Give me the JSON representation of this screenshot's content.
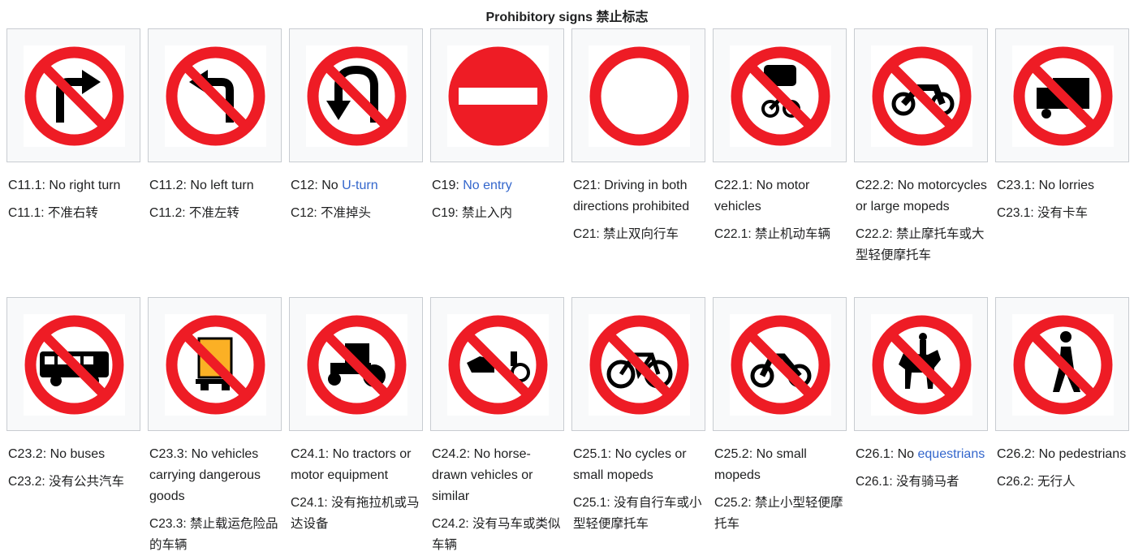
{
  "title": "Prohibitory signs 禁止标志",
  "colors": {
    "sign_red": "#ee1c25",
    "link": "#3366cc",
    "hazard": "#fbb025"
  },
  "rows": [
    [
      {
        "icon": "no-right-turn-icon",
        "code": "C11.1:",
        "en": "No right turn",
        "en_link": "",
        "zh": "C11.1: 不准右转"
      },
      {
        "icon": "no-left-turn-icon",
        "code": "C11.2:",
        "en": "No left turn",
        "en_link": "",
        "zh": "C11.2: 不准左转"
      },
      {
        "icon": "no-u-turn-icon",
        "code": "C12:",
        "en": "No",
        "en_link": "U-turn",
        "zh": "C12: 不准掉头"
      },
      {
        "icon": "no-entry-icon",
        "code": "C19:",
        "en": "",
        "en_link": "No entry",
        "zh": "C19: 禁止入内"
      },
      {
        "icon": "no-vehicles-both-directions-icon",
        "code": "C21:",
        "en": "Driving in both directions prohibited",
        "en_link": "",
        "zh": "C21: 禁止双向行车"
      },
      {
        "icon": "no-motor-vehicles-icon",
        "code": "C22.1:",
        "en": "No motor vehicles",
        "en_link": "",
        "zh": "C22.1: 禁止机动车辆"
      },
      {
        "icon": "no-motorcycles-icon",
        "code": "C22.2:",
        "en": "No motorcycles or large mopeds",
        "en_link": "",
        "zh": "C22.2: 禁止摩托车或大型轻便摩托车"
      },
      {
        "icon": "no-lorries-icon",
        "code": "C23.1:",
        "en": "No lorries",
        "en_link": "",
        "zh": "C23.1: 没有卡车"
      }
    ],
    [
      {
        "icon": "no-buses-icon",
        "code": "C23.2:",
        "en": "No buses",
        "en_link": "",
        "zh": "C23.2: 没有公共汽车"
      },
      {
        "icon": "no-dangerous-goods-icon",
        "code": "C23.3:",
        "en": "No vehicles carrying dangerous goods",
        "en_link": "",
        "zh": "C23.3: 禁止载运危险品的车辆"
      },
      {
        "icon": "no-tractors-icon",
        "code": "C24.1:",
        "en": "No tractors or motor equipment",
        "en_link": "",
        "zh": "C24.1: 没有拖拉机或马达设备"
      },
      {
        "icon": "no-horse-drawn-icon",
        "code": "C24.2:",
        "en": "No horse-drawn vehicles or similar",
        "en_link": "",
        "zh": "C24.2: 没有马车或类似车辆"
      },
      {
        "icon": "no-cycles-icon",
        "code": "C25.1:",
        "en": "No cycles or small mopeds",
        "en_link": "",
        "zh": "C25.1: 没有自行车或小型轻便摩托车"
      },
      {
        "icon": "no-small-mopeds-icon",
        "code": "C25.2:",
        "en": "No small mopeds",
        "en_link": "",
        "zh": "C25.2: 禁止小型轻便摩托车"
      },
      {
        "icon": "no-equestrians-icon",
        "code": "C26.1:",
        "en": "No",
        "en_link": "equestrians",
        "zh": "C26.1: 没有骑马者"
      },
      {
        "icon": "no-pedestrians-icon",
        "code": "C26.2:",
        "en": "No pedestrians",
        "en_link": "",
        "zh": "C26.2: 无行人"
      }
    ]
  ]
}
